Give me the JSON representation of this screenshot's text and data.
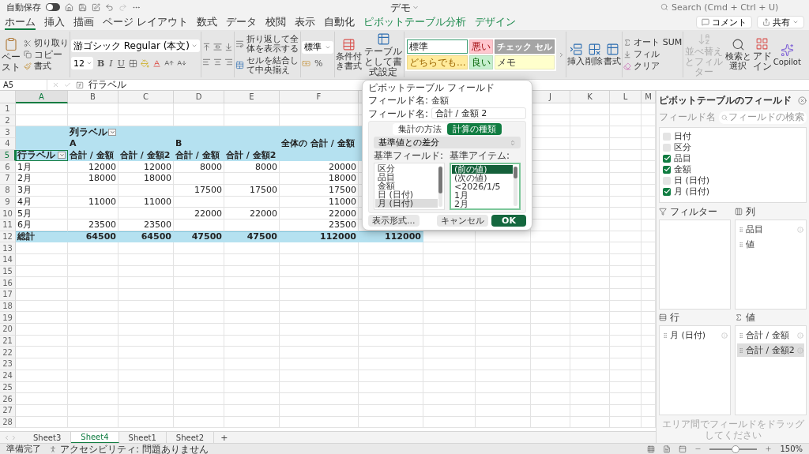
{
  "title_bar": {
    "autosave_label": "自動保存",
    "autosave_on": false,
    "document_title": "デモ",
    "search_placeholder": "Search (Cmd + Ctrl + U)"
  },
  "ribbon_tabs": [
    {
      "label": "ホーム",
      "selected": true,
      "contextual": false
    },
    {
      "label": "挿入",
      "selected": false,
      "contextual": false
    },
    {
      "label": "描画",
      "selected": false,
      "contextual": false
    },
    {
      "label": "ページ レイアウト",
      "selected": false,
      "contextual": false
    },
    {
      "label": "数式",
      "selected": false,
      "contextual": false
    },
    {
      "label": "データ",
      "selected": false,
      "contextual": false
    },
    {
      "label": "校閲",
      "selected": false,
      "contextual": false
    },
    {
      "label": "表示",
      "selected": false,
      "contextual": false
    },
    {
      "label": "自動化",
      "selected": false,
      "contextual": false
    },
    {
      "label": "ピボットテーブル分析",
      "selected": false,
      "contextual": true
    },
    {
      "label": "デザイン",
      "selected": false,
      "contextual": true
    }
  ],
  "header_buttons": [
    {
      "label": "コメント",
      "kind": "comment"
    },
    {
      "label": "共有",
      "kind": "share"
    }
  ],
  "ribbon": {
    "clipboard": {
      "paste": "ペースト",
      "cut": "切り取り",
      "copy": "コピー",
      "format_painter": "書式"
    },
    "font": {
      "name": "游ゴシック Regular (本文)",
      "size": "12",
      "bold": "B",
      "italic": "I",
      "underline": "U"
    },
    "alignment": {
      "wrap": "折り返して全体を表示する",
      "merge": "セルを結合して中央揃え"
    },
    "number": {
      "format": "標準",
      "percent": "%"
    },
    "conditional_format": "条件付き書式",
    "format_as_table": "テーブルとして書式設定",
    "cell_styles": [
      {
        "label": "標準",
        "kind": "normal",
        "color": "#ffffff",
        "selected": true
      },
      {
        "label": "どちらでも...",
        "kind": "neutral",
        "color": "#ffeb9c",
        "selected": false
      },
      {
        "label": "悪い",
        "kind": "bad",
        "color": "#ffc7ce",
        "selected": false
      },
      {
        "label": "良い",
        "kind": "good",
        "color": "#c6efce",
        "selected": false
      },
      {
        "label": "チェック セル",
        "kind": "check",
        "color": "#a5a5a5",
        "selected": false
      },
      {
        "label": "メモ",
        "kind": "note",
        "color": "#ffffcc",
        "selected": false
      }
    ],
    "cells": [
      {
        "label": "挿入",
        "kind": "insert"
      },
      {
        "label": "削除",
        "kind": "delete"
      },
      {
        "label": "書式",
        "kind": "format"
      }
    ],
    "editing": [
      {
        "label": "オート SUM",
        "kind": "sum"
      },
      {
        "label": "フィル",
        "kind": "fill"
      },
      {
        "label": "クリア",
        "kind": "clear"
      }
    ],
    "big_buttons": [
      {
        "label": "並べ替えとフィルター",
        "kind": "sort",
        "disabled": true
      },
      {
        "label": "検索と選択",
        "kind": "find",
        "disabled": false
      },
      {
        "label": "アドイン",
        "kind": "addin",
        "disabled": false
      },
      {
        "label": "Copilot",
        "kind": "copilot",
        "disabled": false
      }
    ]
  },
  "formula_bar": {
    "name_box": "A5",
    "formula": "行ラベル"
  },
  "sheet": {
    "columns": [
      {
        "label": "A",
        "selected": true
      },
      {
        "label": "B",
        "selected": false
      },
      {
        "label": "C",
        "selected": false
      },
      {
        "label": "D",
        "selected": false
      },
      {
        "label": "E",
        "selected": false
      },
      {
        "label": "F",
        "selected": false
      },
      null,
      null,
      null,
      {
        "label": "J",
        "selected": false
      },
      {
        "label": "K",
        "selected": false
      },
      {
        "label": "L",
        "selected": false
      },
      {
        "label": "M",
        "selected": false
      }
    ],
    "rows": [
      {
        "number": "1",
        "selected": false,
        "kind": "blank"
      },
      {
        "number": "2",
        "selected": false,
        "kind": "blank"
      },
      {
        "number": "3",
        "selected": false,
        "kind": "header",
        "cells": [
          null,
          {
            "text": "列ラベル",
            "filter": true,
            "selected": false
          }
        ]
      },
      {
        "number": "4",
        "selected": false,
        "kind": "header",
        "cells": [
          null,
          "A",
          null,
          "B",
          null,
          "全体の 合計 / 金額"
        ]
      },
      {
        "number": "5",
        "selected": true,
        "kind": "header",
        "cells": [
          {
            "text": "行ラベル",
            "filter": true,
            "selected": true
          },
          "合計 / 金額",
          "合計 / 金額2",
          "合計 / 金額",
          "合計 / 金額2"
        ]
      },
      {
        "number": "6",
        "selected": false,
        "kind": "data",
        "cells": [
          "1月",
          "12000",
          "12000",
          "8000",
          "8000",
          "20000"
        ]
      },
      {
        "number": "7",
        "selected": false,
        "kind": "data",
        "cells": [
          "2月",
          "18000",
          "18000",
          null,
          null,
          "18000"
        ]
      },
      {
        "number": "8",
        "selected": false,
        "kind": "data",
        "cells": [
          "3月",
          null,
          null,
          "17500",
          "17500",
          "17500"
        ]
      },
      {
        "number": "9",
        "selected": false,
        "kind": "data",
        "cells": [
          "4月",
          "11000",
          "11000",
          null,
          null,
          "11000"
        ]
      },
      {
        "number": "10",
        "selected": false,
        "kind": "data",
        "cells": [
          "5月",
          null,
          null,
          "22000",
          "22000",
          "22000"
        ]
      },
      {
        "number": "11",
        "selected": false,
        "kind": "data",
        "cells": [
          "6月",
          "23500",
          "23500",
          null,
          null,
          "23500"
        ]
      },
      {
        "number": "12",
        "selected": false,
        "kind": "total",
        "cells": [
          "総計",
          "64500",
          "64500",
          "47500",
          "47500",
          "112000",
          "112000"
        ]
      },
      {
        "number": "13",
        "selected": false,
        "kind": "blank"
      },
      {
        "number": "14",
        "selected": false,
        "kind": "blank"
      },
      {
        "number": "15",
        "selected": false,
        "kind": "blank"
      },
      {
        "number": "16",
        "selected": false,
        "kind": "blank"
      },
      {
        "number": "17",
        "selected": false,
        "kind": "blank"
      },
      {
        "number": "18",
        "selected": false,
        "kind": "blank"
      },
      {
        "number": "19",
        "selected": false,
        "kind": "blank"
      },
      {
        "number": "20",
        "selected": false,
        "kind": "blank"
      },
      {
        "number": "21",
        "selected": false,
        "kind": "blank"
      },
      {
        "number": "22",
        "selected": false,
        "kind": "blank"
      },
      {
        "number": "23",
        "selected": false,
        "kind": "blank"
      },
      {
        "number": "24",
        "selected": false,
        "kind": "blank"
      },
      {
        "number": "25",
        "selected": false,
        "kind": "blank"
      },
      {
        "number": "26",
        "selected": false,
        "kind": "blank"
      },
      {
        "number": "27",
        "selected": false,
        "kind": "blank"
      },
      {
        "number": "28",
        "selected": false,
        "kind": "blank"
      }
    ]
  },
  "dialog": {
    "title": "ピボットテーブル フィールド",
    "source_label": "フィールド名:",
    "source_value": "金額",
    "name_label": "フィールド名:",
    "name_value": "合計 / 金額 2",
    "tabs": [
      {
        "label": "集計の方法",
        "selected": false
      },
      {
        "label": "計算の種類",
        "selected": true
      }
    ],
    "calculation": "基準値との差分",
    "base_field_label": "基準フィールド:",
    "base_fields": [
      {
        "label": "区分",
        "selected": false
      },
      {
        "label": "品目",
        "selected": false
      },
      {
        "label": "金額",
        "selected": false
      },
      {
        "label": "日 (日付)",
        "selected": false
      },
      {
        "label": "月 (日付)",
        "selected": true
      }
    ],
    "base_item_label": "基準アイテム:",
    "base_items": [
      {
        "label": "(前の値)",
        "selected": true
      },
      {
        "label": "(次の値)",
        "selected": false
      },
      {
        "label": "<2026/1/5",
        "selected": false
      },
      {
        "label": "1月",
        "selected": false
      },
      {
        "label": "2月",
        "selected": false
      }
    ],
    "buttons": [
      {
        "label": "表示形式...",
        "kind": "secondary"
      },
      {
        "label": "キャンセル",
        "kind": "secondary"
      },
      {
        "label": "OK",
        "kind": "primary"
      }
    ]
  },
  "sheet_tabs": [
    {
      "label": "Sheet3",
      "selected": false
    },
    {
      "label": "Sheet4",
      "selected": true
    },
    {
      "label": "Sheet1",
      "selected": false
    },
    {
      "label": "Sheet2",
      "selected": false
    }
  ],
  "add_sheet": "+",
  "pivot_pane": {
    "title": "ピボットテーブルのフィールド",
    "field_name_label": "フィールド名",
    "search_placeholder": "フィールドの検索",
    "fields": [
      {
        "label": "日付",
        "checked": false
      },
      {
        "label": "区分",
        "checked": false
      },
      {
        "label": "品目",
        "checked": true
      },
      {
        "label": "金額",
        "checked": true
      },
      {
        "label": "日 (日付)",
        "checked": false
      },
      {
        "label": "月 (日付)",
        "checked": true
      }
    ],
    "areas": [
      {
        "kind": "filter",
        "label": "フィルター"
      },
      {
        "kind": "columns",
        "label": "列",
        "items": [
          {
            "label": "品目",
            "info": true,
            "selected": false
          },
          {
            "label": "値",
            "info": false,
            "selected": false
          }
        ]
      },
      {
        "kind": "rows",
        "label": "行",
        "items": [
          {
            "label": "月 (日付)",
            "info": true,
            "selected": false
          }
        ]
      },
      {
        "kind": "values",
        "label": "値",
        "items": [
          {
            "label": "合計 / 金額",
            "info": true,
            "selected": false
          },
          {
            "label": "合計 / 金額2",
            "info": true,
            "selected": true
          }
        ]
      }
    ],
    "hint": "エリア間でフィールドをドラッグしてください"
  },
  "status_bar": {
    "ready": "準備完了",
    "accessibility": "アクセシビリティ: 問題ありません",
    "zoom_slider": {
      "level": 0.55
    },
    "zoom": "150%"
  }
}
